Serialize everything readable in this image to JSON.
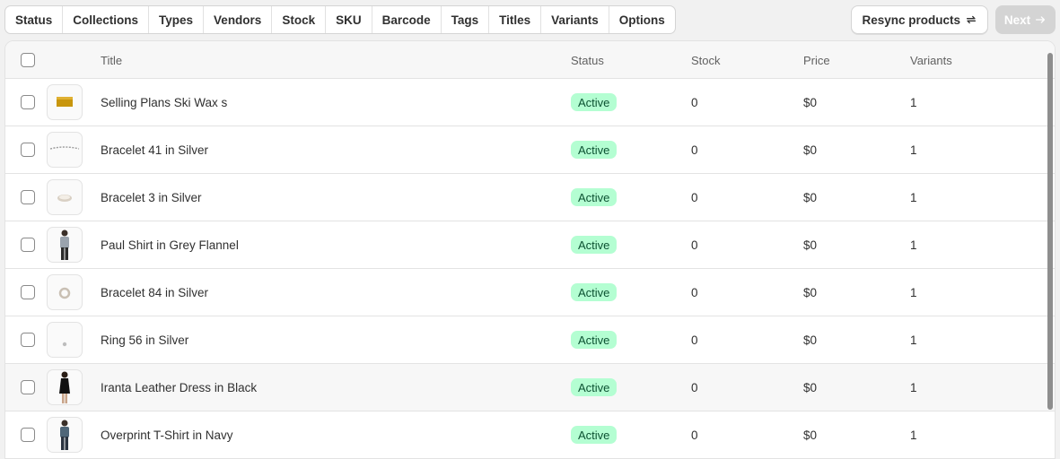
{
  "filters": [
    "Status",
    "Collections",
    "Types",
    "Vendors",
    "Stock",
    "SKU",
    "Barcode",
    "Tags",
    "Titles",
    "Variants",
    "Options"
  ],
  "actions": {
    "resync_label": "Resync products",
    "next_label": "Next"
  },
  "columns": {
    "title": "Title",
    "status": "Status",
    "stock": "Stock",
    "price": "Price",
    "variants": "Variants"
  },
  "rows": [
    {
      "title": "Selling Plans Ski Wax s",
      "status": "Active",
      "stock": "0",
      "price": "$0",
      "variants": "1",
      "thumb": "wax"
    },
    {
      "title": "Bracelet 41 in Silver",
      "status": "Active",
      "stock": "0",
      "price": "$0",
      "variants": "1",
      "thumb": "chain"
    },
    {
      "title": "Bracelet 3 in Silver",
      "status": "Active",
      "stock": "0",
      "price": "$0",
      "variants": "1",
      "thumb": "bangle"
    },
    {
      "title": "Paul Shirt in Grey Flannel",
      "status": "Active",
      "stock": "0",
      "price": "$0",
      "variants": "1",
      "thumb": "person-grey"
    },
    {
      "title": "Bracelet 84 in Silver",
      "status": "Active",
      "stock": "0",
      "price": "$0",
      "variants": "1",
      "thumb": "bracelet"
    },
    {
      "title": "Ring 56 in Silver",
      "status": "Active",
      "stock": "0",
      "price": "$0",
      "variants": "1",
      "thumb": "ring"
    },
    {
      "title": "Iranta Leather Dress in Black",
      "status": "Active",
      "stock": "0",
      "price": "$0",
      "variants": "1",
      "thumb": "person-black"
    },
    {
      "title": "Overprint T-Shirt in Navy",
      "status": "Active",
      "stock": "0",
      "price": "$0",
      "variants": "1",
      "thumb": "person-navy"
    }
  ],
  "colors": {
    "badge_bg": "#b4fed2",
    "badge_text": "#0c5132",
    "next_disabled": "#d4d4d4"
  }
}
